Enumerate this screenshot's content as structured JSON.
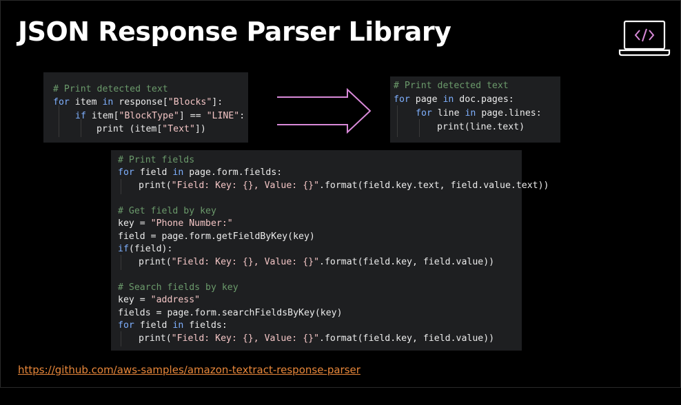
{
  "title": "JSON Response Parser Library",
  "link": "https://github.com/aws-samples/amazon-textract-response-parser",
  "colors": {
    "background": "#000000",
    "code_bg": "#1e1f21",
    "comment": "#6b9a6b",
    "keyword": "#7fb0ff",
    "string": "#f3c5c5",
    "arrow": "#d98ad9",
    "link": "#e8873a"
  },
  "icon": "laptop-code-icon",
  "code_before": {
    "l1": "# Print detected text",
    "l2_kw": "for",
    "l2_a": " item ",
    "l2_kw2": "in",
    "l2_b": " response[",
    "l2_str": "\"Blocks\"",
    "l2_c": "]:",
    "l3_kw": "if",
    "l3_a": " item[",
    "l3_str": "\"BlockType\"",
    "l3_b": "] == ",
    "l3_str2": "\"LINE\"",
    "l3_c": ":",
    "l4_a": "print (item[",
    "l4_str": "\"Text\"",
    "l4_b": "])"
  },
  "code_after": {
    "l1": "# Print detected text",
    "l2_kw": "for",
    "l2_a": " page ",
    "l2_kw2": "in",
    "l2_b": " doc.pages:",
    "l3_kw": "for",
    "l3_a": " line ",
    "l3_kw2": "in",
    "l3_b": " page.lines:",
    "l4_a": "print(line.text)"
  },
  "code_fields": {
    "c1": "# Print fields",
    "f1_kw": "for",
    "f1_a": " field ",
    "f1_kw2": "in",
    "f1_b": " page.form.fields:",
    "f2_a": "print(",
    "f2_str": "\"Field: Key: {}, Value: {}\"",
    "f2_b": ".format(field.key.text, field.value.text))",
    "c2": "# Get field by key",
    "g1_a": "key = ",
    "g1_str": "\"Phone Number:\"",
    "g2": "field = page.form.getFieldByKey(key)",
    "g3_kw": "if",
    "g3_a": "(field):",
    "g4_a": "print(",
    "g4_str": "\"Field: Key: {}, Value: {}\"",
    "g4_b": ".format(field.key, field.value))",
    "c3": "# Search fields by key",
    "s1_a": "key = ",
    "s1_str": "\"address\"",
    "s2": "fields = page.form.searchFieldsByKey(key)",
    "s3_kw": "for",
    "s3_a": " field ",
    "s3_kw2": "in",
    "s3_b": " fields:",
    "s4_a": "print(",
    "s4_str": "\"Field: Key: {}, Value: {}\"",
    "s4_b": ".format(field.key, field.value))"
  }
}
